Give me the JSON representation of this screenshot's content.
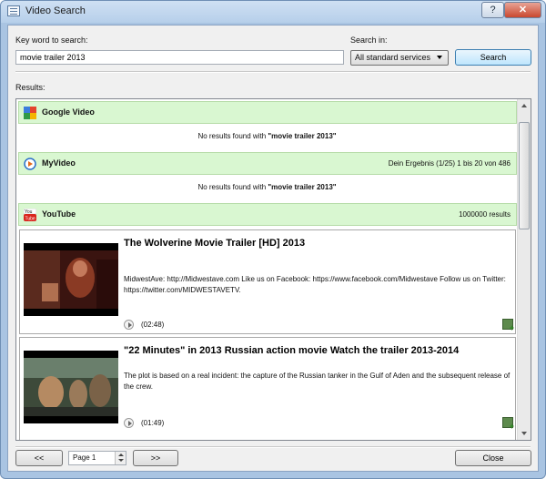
{
  "window": {
    "title": "Video Search",
    "help_label": "?",
    "close_label": "✕"
  },
  "search": {
    "keyword_label": "Key word to search:",
    "keyword_value": "movie trailer 2013",
    "search_in_label": "Search in:",
    "search_in_value": "All standard services",
    "search_button": "Search"
  },
  "results": {
    "label": "Results:",
    "services": [
      {
        "name": "Google Video",
        "icon": "google-icon",
        "right_text": "",
        "no_result_prefix": "No results found with ",
        "no_result_query": "\"movie trailer 2013\""
      },
      {
        "name": "MyVideo",
        "icon": "myvideo-icon",
        "right_text": "Dein Ergebnis (1/25) 1 bis 20 von 486",
        "no_result_prefix": "No results found with ",
        "no_result_query": "\"movie trailer 2013\""
      },
      {
        "name": "YouTube",
        "icon": "youtube-icon",
        "right_text": "1000000 results"
      }
    ],
    "videos": [
      {
        "title": "The Wolverine Movie Trailer [HD] 2013",
        "description": "MidwestAve: http://Midwestave.com Like us on Facebook: https://www.facebook.com/Midwestave Follow us on Twitter: https://twitter.com/MIDWESTAVETV.",
        "duration": "(02:48)"
      },
      {
        "title": "\"22 Minutes\" in 2013 Russian action movie Watch the trailer 2013-2014",
        "description": "The plot is based on a real incident: the capture of the Russian tanker in the Gulf of Aden and the subsequent release of the crew.",
        "duration": "(01:49)"
      }
    ]
  },
  "footer": {
    "prev_label": "<<",
    "page_value": "Page 1",
    "next_label": ">>",
    "close_label": "Close"
  }
}
